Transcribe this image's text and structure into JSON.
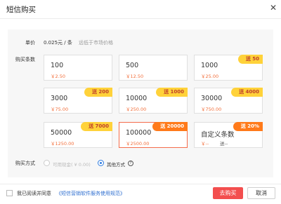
{
  "dialog": {
    "title": "短信购买",
    "close_icon": "close-icon"
  },
  "price": {
    "label": "单价",
    "value": "0.025元 / 条",
    "note": "远低于市场价格"
  },
  "packages": {
    "label": "购买条数",
    "items": [
      {
        "qty": "100",
        "price": "￥2.50",
        "badge": ""
      },
      {
        "qty": "500",
        "price": "￥12.50",
        "badge": ""
      },
      {
        "qty": "1000",
        "price": "￥25.00",
        "badge": "送 50"
      },
      {
        "qty": "3000",
        "price": "￥75.00",
        "badge": "送 200"
      },
      {
        "qty": "10000",
        "price": "￥250.00",
        "badge": "送 1000"
      },
      {
        "qty": "30000",
        "price": "￥750.00",
        "badge": "送 4000"
      },
      {
        "qty": "50000",
        "price": "￥1250.00",
        "badge": "送 7000"
      },
      {
        "qty": "100000",
        "price": "￥2500.00",
        "badge": "送 20000",
        "selected": true
      },
      {
        "qty": "自定义条数",
        "price": "￥--",
        "badge": "送 20%",
        "extra": "送--"
      }
    ]
  },
  "payment": {
    "label": "购买方式",
    "option_balance": "可用现金( ¥ 0.00)",
    "option_other": "其他方式",
    "help_icon": "question-icon",
    "selected": "other"
  },
  "footer": {
    "agree_text": "我已阅读并同意",
    "agree_link": "《短信营销软件服务使用规范》",
    "buy_label": "去购买",
    "cancel_label": "取消"
  },
  "colors": {
    "accent_red": "#f34e4e",
    "badge_yellow": "#ffd23a",
    "badge_orange": "#ff7a1a",
    "link_blue": "#2f6fd0",
    "radio_blue": "#2f7de1"
  }
}
